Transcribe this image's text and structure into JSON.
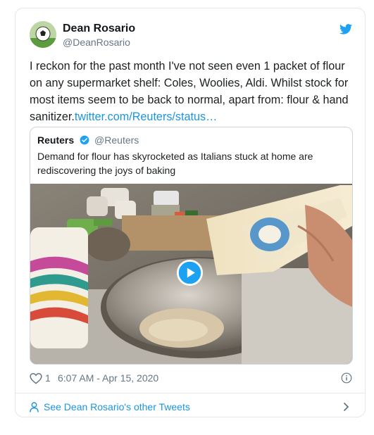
{
  "tweet": {
    "author": {
      "name": "Dean Rosario",
      "handle": "@DeanRosario",
      "avatar_icon": "soccer-ball-avatar"
    },
    "text": "I reckon for the past month I've not seen even 1 packet of flour on any supermarket shelf: Coles, Woolies, Aldi.  Whilst stock for most items seem to be back to normal, apart from: flour & hand sanitizer.",
    "link_text": "twitter.com/Reuters/status…",
    "quoted": {
      "name": "Reuters",
      "handle": "@Reuters",
      "verified_icon": "verified-badge-icon",
      "text": "Demand for flour has skyrocketed as Italians stuck at home are rediscovering the joys of baking",
      "media_icon": "play-button-icon"
    },
    "likes": "1",
    "timestamp": "6:07 AM - Apr 15, 2020"
  },
  "footer": {
    "label": "See Dean Rosario's other Tweets"
  },
  "colors": {
    "accent": "#1b95e0",
    "twitter_blue": "#1da1f2",
    "secondary_text": "#657786",
    "border": "#e1e8ed"
  },
  "icons": [
    "twitter-logo-icon",
    "verified-badge-icon",
    "play-button-icon",
    "heart-icon",
    "info-icon",
    "person-icon",
    "chevron-right-icon"
  ]
}
